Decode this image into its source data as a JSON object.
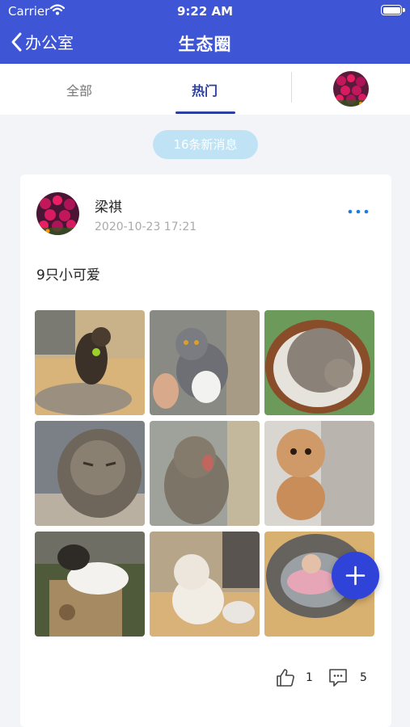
{
  "status_bar": {
    "carrier": "Carrier",
    "time": "9:22 AM",
    "icons": [
      "wifi-icon",
      "battery-icon"
    ]
  },
  "nav": {
    "back_label": "办公室",
    "title": "生态圈",
    "back_icon": "chevron-left-icon"
  },
  "tabs": {
    "items": [
      {
        "label": "全部",
        "active": false
      },
      {
        "label": "热门",
        "active": true
      }
    ]
  },
  "new_messages": {
    "label": "16条新消息"
  },
  "post": {
    "author": "梁祺",
    "time": "2020-10-23 17:21",
    "text": "9只小可爱",
    "photo_count": 9,
    "likes": "1",
    "comments": "5"
  },
  "colors": {
    "brand": "#3e55d6",
    "tab_active": "#2c3f9e",
    "pill": "#bfe3f5",
    "fab": "#2f43d9",
    "more_dots": "#1e7ae6"
  }
}
